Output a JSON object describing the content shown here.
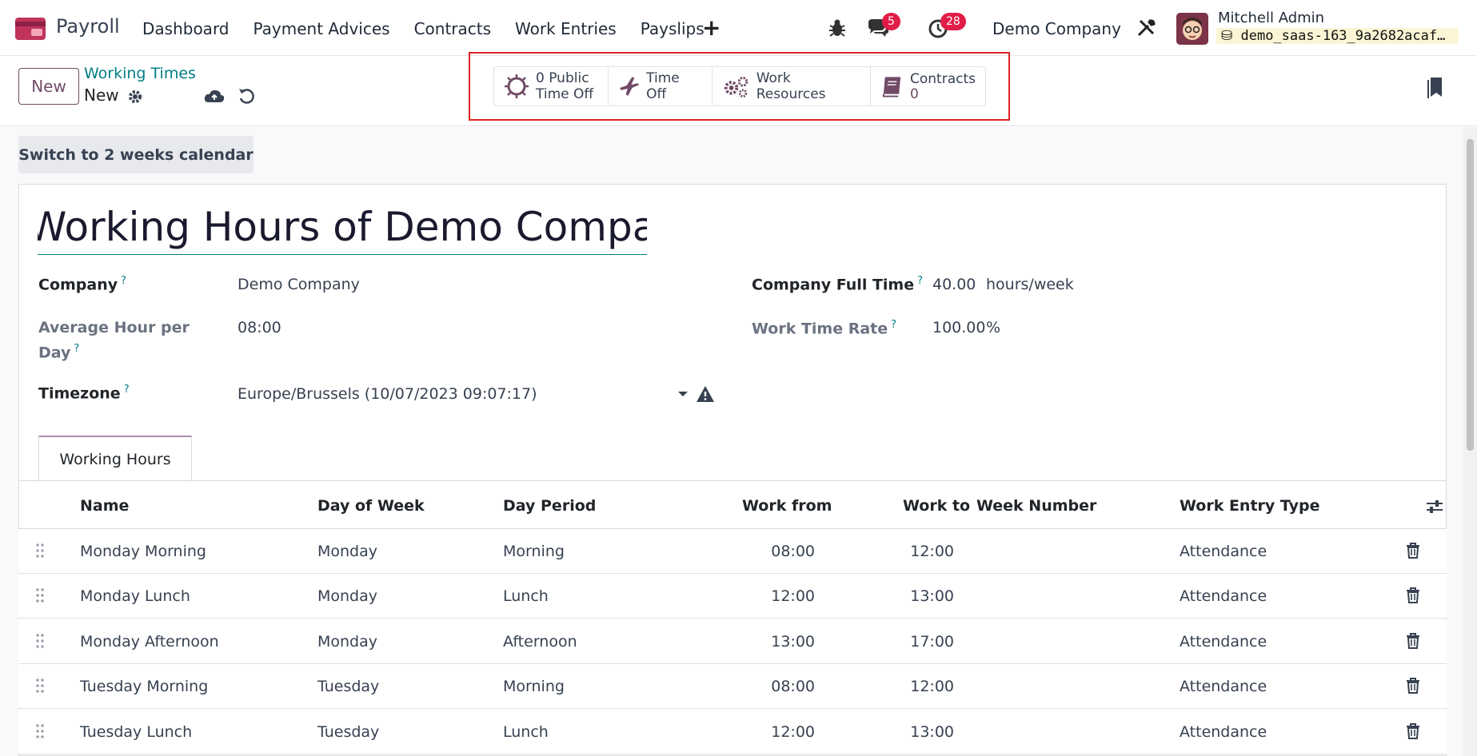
{
  "nav": {
    "app_name": "Payroll",
    "menu": [
      "Dashboard",
      "Payment Advices",
      "Contracts",
      "Work Entries",
      "Payslips"
    ],
    "messages_count": "5",
    "activities_count": "28",
    "company": "Demo Company",
    "user_name": "Mitchell Admin",
    "database": "demo_saas-163_9a2682acaf…"
  },
  "control": {
    "new_label": "New",
    "breadcrumb": "Working Times",
    "record": "New",
    "smart_buttons": [
      {
        "num": "0",
        "label": "Public\nTime Off",
        "icon": "sun-icon"
      },
      {
        "label": "Time Off",
        "icon": "plane-icon"
      },
      {
        "label": "Work Resources",
        "icon": "gears-icon"
      },
      {
        "label": "Contracts",
        "num": "0",
        "icon": "book-icon"
      }
    ]
  },
  "switch_label": "Switch to 2 weeks calendar",
  "form": {
    "title": "Working Hours of Demo Company",
    "company_label": "Company",
    "company_value": "Demo Company",
    "avg_label_1": "Average Hour per",
    "avg_label_2": "Day",
    "avg_value": "08:00",
    "timezone_label": "Timezone",
    "timezone_value": "Europe/Brussels (10/07/2023 09:07:17)",
    "full_time_label": "Company Full Time",
    "full_time_value": "40.00",
    "full_time_unit": "hours/week",
    "rate_label": "Work Time Rate",
    "rate_value": "100.00",
    "rate_unit": "%"
  },
  "tab": "Working Hours",
  "table": {
    "headers": [
      "Name",
      "Day of Week",
      "Day Period",
      "Work from",
      "Work to",
      "Week Number",
      "Work Entry Type"
    ],
    "rows": [
      [
        "Monday Morning",
        "Monday",
        "Morning",
        "08:00",
        "12:00",
        "",
        "Attendance"
      ],
      [
        "Monday Lunch",
        "Monday",
        "Lunch",
        "12:00",
        "13:00",
        "",
        "Attendance"
      ],
      [
        "Monday Afternoon",
        "Monday",
        "Afternoon",
        "13:00",
        "17:00",
        "",
        "Attendance"
      ],
      [
        "Tuesday Morning",
        "Tuesday",
        "Morning",
        "08:00",
        "12:00",
        "",
        "Attendance"
      ],
      [
        "Tuesday Lunch",
        "Tuesday",
        "Lunch",
        "12:00",
        "13:00",
        "",
        "Attendance"
      ]
    ]
  },
  "colors": {
    "brand": "#714b67",
    "accent": "#017e84",
    "badge": "#e11d48",
    "highlight_box": "#e02424"
  }
}
